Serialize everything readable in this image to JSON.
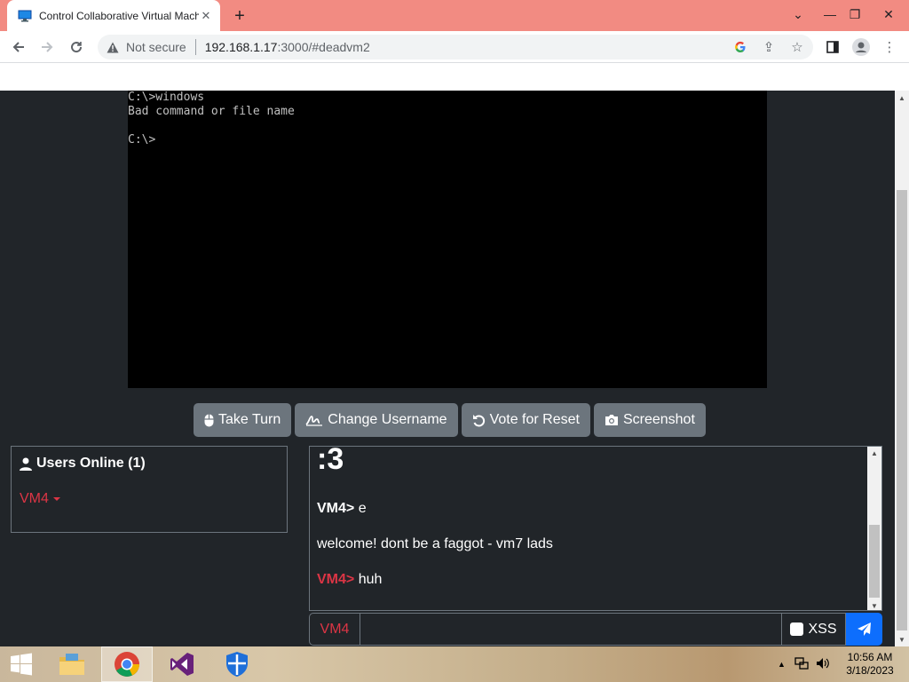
{
  "browser": {
    "tab_title": "Control Collaborative Virtual Machines",
    "security_label": "Not secure",
    "url_host": "192.168.1.17",
    "url_rest": ":3000/#deadvm2",
    "colors": {
      "tabstrip": "#f28b82"
    }
  },
  "vm": {
    "lines": [
      "C:\\>windows",
      "Bad command or file name",
      "",
      "C:\\>"
    ]
  },
  "buttons": {
    "take_turn": "Take Turn",
    "change_username": "Change Username",
    "vote_reset": "Vote for Reset",
    "screenshot": "Screenshot"
  },
  "users": {
    "header": "Users Online (1)",
    "list": [
      "VM4"
    ]
  },
  "chat": {
    "big_message": ":3",
    "messages": [
      {
        "user": "VM4",
        "sep": "> ",
        "text": "e"
      },
      {
        "user": "",
        "sep": "",
        "text": "welcome! dont be a faggot - vm7 lads"
      },
      {
        "user": "VM4",
        "sep": "> ",
        "text": "huh"
      }
    ],
    "input_username": "VM4",
    "input_placeholder": "",
    "xss_label": "XSS"
  },
  "taskbar": {
    "time": "10:56 AM",
    "date": "3/18/2023"
  },
  "theme": {
    "background": "#212529",
    "accent": "#dc3545",
    "button": "#6c757d",
    "primary": "#0d6efd"
  }
}
